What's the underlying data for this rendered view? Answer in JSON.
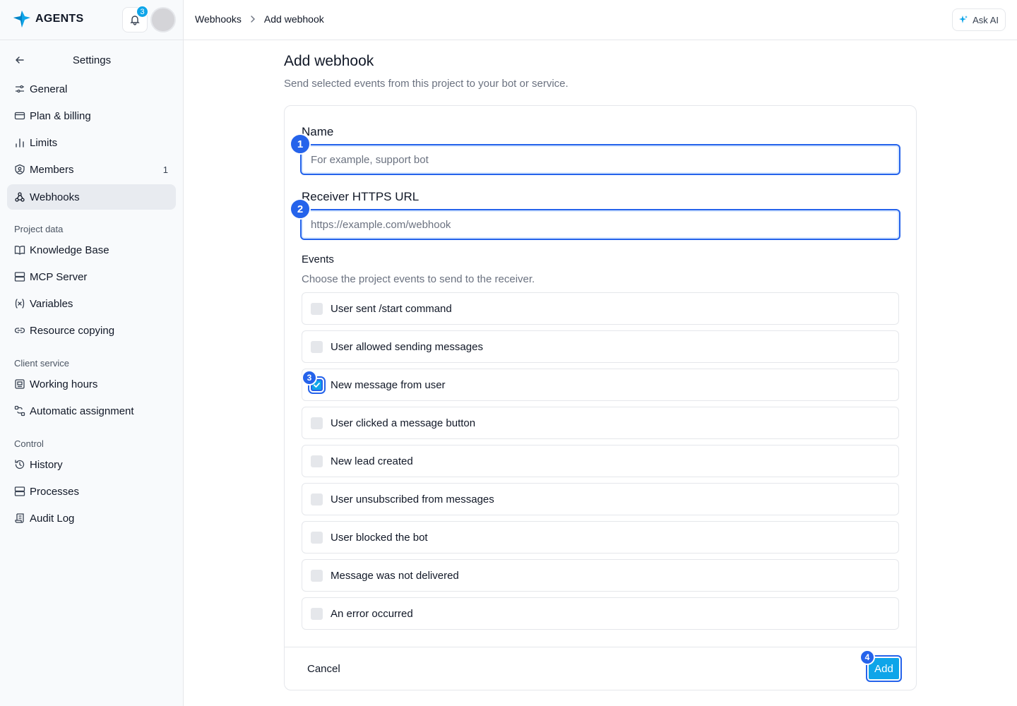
{
  "brand": {
    "name": "AGENTS",
    "accent": "#0ea5e9"
  },
  "header": {
    "notifications_count": "3",
    "breadcrumb": [
      "Webhooks",
      "Add webhook"
    ],
    "ask_ai_label": "Ask AI"
  },
  "sidebar": {
    "title": "Settings",
    "items": [
      {
        "label": "General",
        "icon": "sliders-icon"
      },
      {
        "label": "Plan & billing",
        "icon": "credit-card-icon"
      },
      {
        "label": "Limits",
        "icon": "bar-chart-icon"
      },
      {
        "label": "Members",
        "icon": "user-shield-icon",
        "count": "1"
      },
      {
        "label": "Webhooks",
        "icon": "webhook-icon",
        "active": true
      }
    ],
    "sections": [
      {
        "title": "Project data",
        "items": [
          {
            "label": "Knowledge Base",
            "icon": "book-icon"
          },
          {
            "label": "MCP Server",
            "icon": "server-icon"
          },
          {
            "label": "Variables",
            "icon": "variable-icon"
          },
          {
            "label": "Resource copying",
            "icon": "link-icon"
          }
        ]
      },
      {
        "title": "Client service",
        "items": [
          {
            "label": "Working hours",
            "icon": "calendar-icon"
          },
          {
            "label": "Automatic assignment",
            "icon": "route-icon"
          }
        ]
      },
      {
        "title": "Control",
        "items": [
          {
            "label": "History",
            "icon": "history-icon"
          },
          {
            "label": "Processes",
            "icon": "server-icon"
          },
          {
            "label": "Audit Log",
            "icon": "scroll-icon"
          }
        ]
      }
    ]
  },
  "main": {
    "title": "Add webhook",
    "subtitle": "Send selected events from this project to your bot or service.",
    "name_field": {
      "label": "Name",
      "value": "",
      "placeholder": "For example, support bot"
    },
    "url_field": {
      "label": "Receiver HTTPS URL",
      "value": "",
      "placeholder": "https://example.com/webhook"
    },
    "events": {
      "title": "Events",
      "subtitle": "Choose the project events to send to the receiver.",
      "items": [
        {
          "label": "User sent /start command",
          "checked": false
        },
        {
          "label": "User allowed sending messages",
          "checked": false
        },
        {
          "label": "New message from user",
          "checked": true
        },
        {
          "label": "User clicked a message button",
          "checked": false
        },
        {
          "label": "New lead created",
          "checked": false
        },
        {
          "label": "User unsubscribed from messages",
          "checked": false
        },
        {
          "label": "User blocked the bot",
          "checked": false
        },
        {
          "label": "Message was not delivered",
          "checked": false
        },
        {
          "label": "An error occurred",
          "checked": false
        }
      ]
    },
    "cancel_label": "Cancel",
    "add_label": "Add"
  },
  "markers": [
    "1",
    "2",
    "3",
    "4"
  ]
}
